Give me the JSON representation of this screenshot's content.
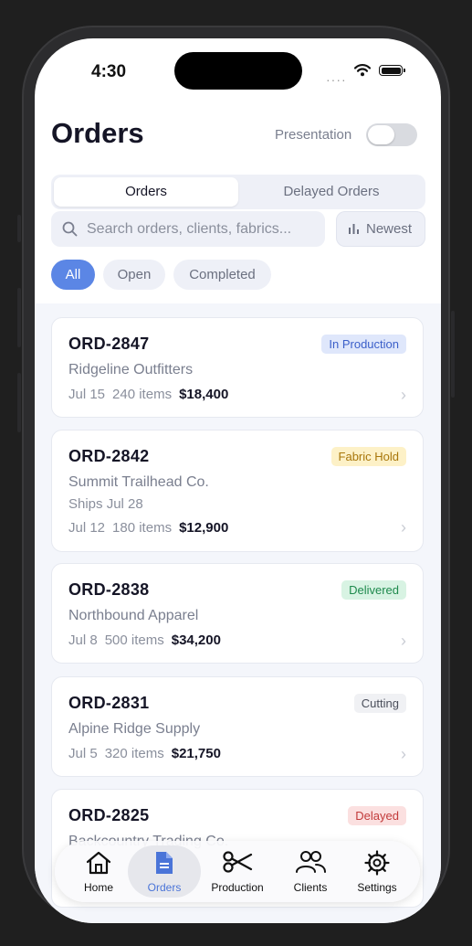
{
  "status": {
    "time": "4:30",
    "signal": "····"
  },
  "header": {
    "title": "Orders",
    "presentation_label": "Presentation",
    "presentation_on": false
  },
  "segments": {
    "orders": "Orders",
    "delayed": "Delayed Orders",
    "active": "orders"
  },
  "search": {
    "placeholder": "Search orders, clients, fabrics...",
    "value": ""
  },
  "sort": {
    "label": "Newest",
    "icon": "bar-chart-icon"
  },
  "filters": {
    "all": "All",
    "open": "Open",
    "completed": "Completed",
    "active": "all"
  },
  "orders": [
    {
      "id": "ORD-2847",
      "client": "Ridgeline Outfitters",
      "ships": "",
      "date": "Jul 15",
      "items": "240 items",
      "amount": "$18,400",
      "status": "In Production",
      "status_bg": "#dfe7fb",
      "status_fg": "#3b5fc9"
    },
    {
      "id": "ORD-2842",
      "client": "Summit Trailhead Co.",
      "ships": "Ships Jul 28",
      "date": "Jul 12",
      "items": "180 items",
      "amount": "$12,900",
      "status": "Fabric Hold",
      "status_bg": "#fdf1c7",
      "status_fg": "#a8760a"
    },
    {
      "id": "ORD-2838",
      "client": "Northbound Apparel",
      "ships": "",
      "date": "Jul 8",
      "items": "500 items",
      "amount": "$34,200",
      "status": "Delivered",
      "status_bg": "#d8f3e3",
      "status_fg": "#1f8a4d"
    },
    {
      "id": "ORD-2831",
      "client": "Alpine Ridge Supply",
      "ships": "",
      "date": "Jul 5",
      "items": "320 items",
      "amount": "$21,750",
      "status": "Cutting",
      "status_bg": "#f0f1f4",
      "status_fg": "#4a4e5a"
    },
    {
      "id": "ORD-2825",
      "client": "Backcountry Trading Co.",
      "ships": "",
      "date": "",
      "items": "",
      "amount": "",
      "status": "Delayed",
      "status_bg": "#fbe0e0",
      "status_fg": "#c23a3a"
    }
  ],
  "tabs": [
    {
      "label": "Home",
      "icon": "home-icon"
    },
    {
      "label": "Orders",
      "icon": "document-icon"
    },
    {
      "label": "Production",
      "icon": "scissors-icon"
    },
    {
      "label": "Clients",
      "icon": "people-icon"
    },
    {
      "label": "Settings",
      "icon": "gear-icon"
    }
  ],
  "colors": {
    "accent": "#5b86e5",
    "tab_active": "#4a74d8"
  }
}
